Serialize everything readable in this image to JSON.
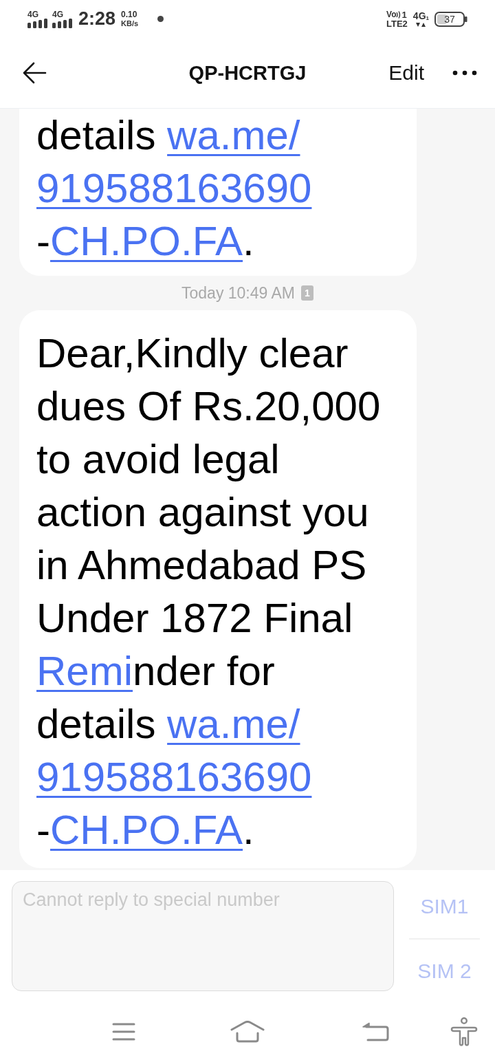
{
  "status_bar": {
    "sims": [
      {
        "network": "4G"
      },
      {
        "network": "4G"
      }
    ],
    "time": "2:28",
    "speed": {
      "value": "0.10",
      "unit": "KB/s"
    },
    "volte": {
      "label": "Vo",
      "sim": "1",
      "network": "LTE2"
    },
    "data": {
      "network": "4G",
      "sim": "1"
    },
    "battery": "37"
  },
  "header": {
    "title": "QP-HCRTGJ",
    "edit": "Edit"
  },
  "conversation": [
    {
      "kind": "message",
      "lines": [
        [
          {
            "kind": "text",
            "text": "details "
          },
          {
            "kind": "link",
            "text": "wa.me/"
          }
        ],
        [
          {
            "kind": "link",
            "text": "919588163690"
          }
        ],
        [
          {
            "kind": "text",
            "text": "-"
          },
          {
            "kind": "link",
            "text": "CH.PO.FA"
          },
          {
            "kind": "text",
            "text": "."
          }
        ]
      ]
    },
    {
      "kind": "timestamp",
      "text": "Today 10:49 AM",
      "sim": "1"
    },
    {
      "kind": "message",
      "lines": [
        [
          {
            "kind": "text",
            "text": "Dear,Kindly clear"
          }
        ],
        [
          {
            "kind": "text",
            "text": "dues Of Rs.20,000"
          }
        ],
        [
          {
            "kind": "text",
            "text": "to avoid legal"
          }
        ],
        [
          {
            "kind": "text",
            "text": "action against you"
          }
        ],
        [
          {
            "kind": "text",
            "text": "in Ahmedabad PS"
          }
        ],
        [
          {
            "kind": "text",
            "text": "Under 1872 Final"
          }
        ],
        [
          {
            "kind": "link",
            "text": "Remi"
          },
          {
            "kind": "text",
            "text": "nder for"
          }
        ],
        [
          {
            "kind": "text",
            "text": "details "
          },
          {
            "kind": "link",
            "text": "wa.me/"
          }
        ],
        [
          {
            "kind": "link",
            "text": "919588163690"
          }
        ],
        [
          {
            "kind": "text",
            "text": "-"
          },
          {
            "kind": "link",
            "text": "CH.PO.FA"
          },
          {
            "kind": "text",
            "text": "."
          }
        ]
      ]
    }
  ],
  "composer": {
    "placeholder": "Cannot reply to special number",
    "disabled": true,
    "sim_buttons": [
      {
        "label": "SIM1",
        "disabled": true
      },
      {
        "label": "SIM 2",
        "disabled": true
      }
    ]
  }
}
